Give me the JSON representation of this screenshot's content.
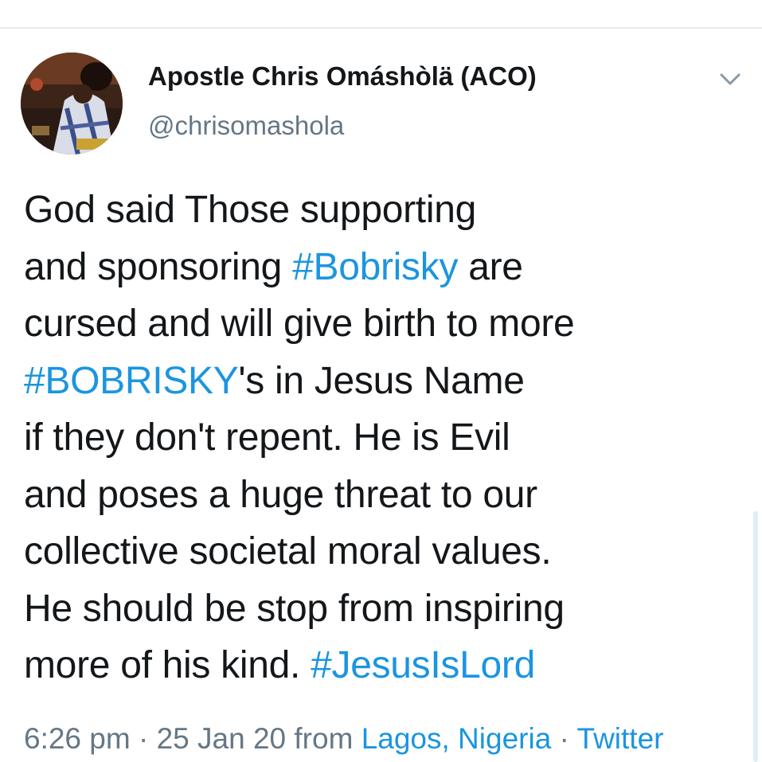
{
  "tweet": {
    "display_name": "Apostle Chris Omáshòlä (ACO)",
    "handle": "@chrisomashola",
    "lines": [
      [
        "God said Those supporting"
      ],
      [
        "and sponsoring ",
        "#Bobrisky",
        " are"
      ],
      [
        "cursed and will give birth to more"
      ],
      [
        "#BOBRISKY",
        "'s in Jesus Name"
      ],
      [
        "if they don't repent. He is Evil"
      ],
      [
        "and poses a huge threat to our"
      ],
      [
        "collective societal moral values."
      ],
      [
        "He should be stop from inspiring"
      ],
      [
        "more of his kind. ",
        "#JesusIsLord"
      ]
    ],
    "time": "6:26 pm",
    "separator": "·",
    "date": "25 Jan 20",
    "from_label": "from",
    "location": "Lagos, Nigeria",
    "source": "Twitter"
  },
  "icons": {
    "menu": "chevron-down-icon"
  },
  "colors": {
    "text": "#14171a",
    "secondary": "#657786",
    "link": "#1b95e0",
    "divider": "#e6ecf0"
  }
}
